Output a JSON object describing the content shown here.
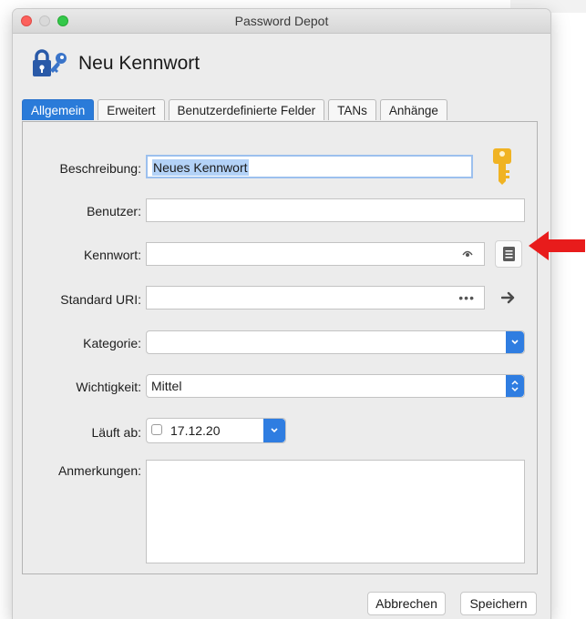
{
  "window": {
    "title": "Password Depot"
  },
  "header": {
    "title": "Neu Kennwort",
    "icon": "lock-key-icon"
  },
  "tabs": [
    {
      "label": "Allgemein",
      "active": true
    },
    {
      "label": "Erweitert",
      "active": false
    },
    {
      "label": "Benutzerdefinierte Felder",
      "active": false
    },
    {
      "label": "TANs",
      "active": false
    },
    {
      "label": "Anhänge",
      "active": false
    }
  ],
  "form": {
    "beschreibung": {
      "label": "Beschreibung:",
      "value": "Neues Kennwort"
    },
    "benutzer": {
      "label": "Benutzer:",
      "value": ""
    },
    "kennwort": {
      "label": "Kennwort:",
      "value": ""
    },
    "uri": {
      "label": "Standard URI:",
      "value": "",
      "dots": "•••"
    },
    "kategorie": {
      "label": "Kategorie:",
      "value": ""
    },
    "wichtigkeit": {
      "label": "Wichtigkeit:",
      "value": "Mittel"
    },
    "laeuft_ab": {
      "label": "Läuft ab:",
      "value": "17.12.20",
      "checked": false
    },
    "anmerkungen": {
      "label": "Anmerkungen:",
      "value": ""
    }
  },
  "buttons": {
    "cancel": "Abbrechen",
    "save": "Speichern"
  },
  "colors": {
    "accent": "#2a7bd9",
    "annotation_arrow": "#e81c1c",
    "key": "#f0b323"
  }
}
